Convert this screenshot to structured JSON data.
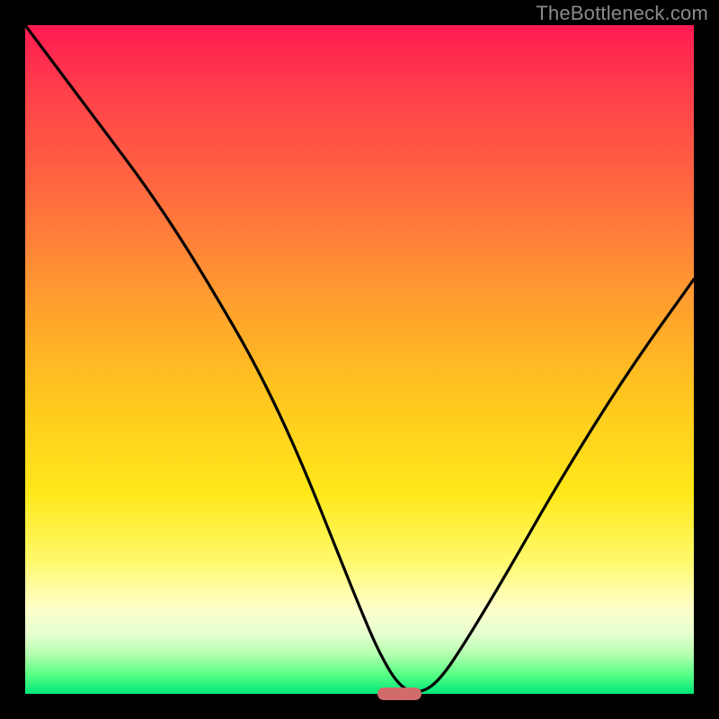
{
  "watermark": "TheBottleneck.com",
  "colors": {
    "frame": "#000000",
    "curve": "#000000",
    "marker": "#d16a6a",
    "gradient_stops": [
      "#ff1a52",
      "#ff3f4a",
      "#ff6a3f",
      "#ff9a30",
      "#ffc51f",
      "#ffe81a",
      "#fff96a",
      "#ffffc8",
      "#e6ffd0",
      "#b6ffb0",
      "#5bff86",
      "#00e878"
    ]
  },
  "marker": {
    "x_pct": 56,
    "width_pct": 6.5
  },
  "chart_data": {
    "type": "line",
    "title": "",
    "xlabel": "",
    "ylabel": "",
    "xlim": [
      0,
      100
    ],
    "ylim": [
      0,
      100
    ],
    "series": [
      {
        "name": "bottleneck-curve",
        "x": [
          0,
          6,
          12,
          18,
          24,
          30,
          34,
          38,
          42,
          46,
          50,
          53,
          56,
          59,
          62,
          66,
          72,
          80,
          90,
          100
        ],
        "y": [
          100,
          92,
          84,
          76,
          67,
          57,
          50,
          42,
          33,
          23,
          13,
          6,
          1,
          0,
          2,
          8,
          18,
          32,
          48,
          62
        ]
      }
    ],
    "annotations": [
      {
        "type": "marker",
        "x": 57.5,
        "y": 0,
        "label": "optimal-range"
      }
    ]
  }
}
